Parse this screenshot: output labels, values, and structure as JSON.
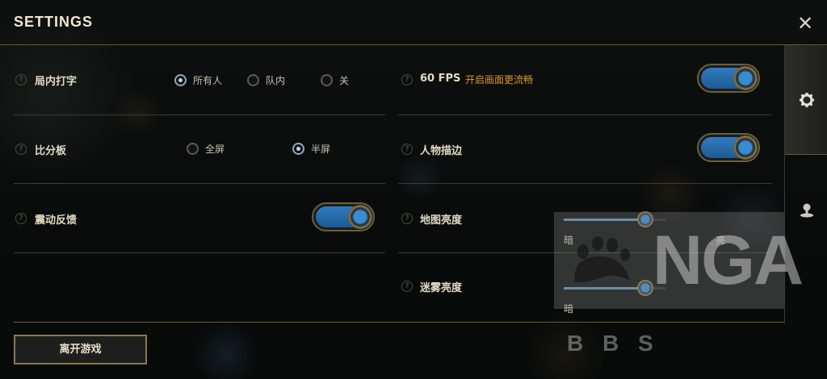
{
  "header": {
    "title": "SETTINGS",
    "close_icon": "close-icon"
  },
  "side_tabs": [
    {
      "icon": "gear-icon",
      "active": true
    },
    {
      "icon": "map-pin-icon",
      "active": false
    }
  ],
  "left": {
    "chat": {
      "label": "局内打字",
      "options": [
        "所有人",
        "队内",
        "关"
      ],
      "selected": "所有人"
    },
    "scoreboard": {
      "label": "比分板",
      "options": [
        "全屏",
        "半屏"
      ],
      "selected": "半屏"
    },
    "vibration": {
      "label": "震动反馈",
      "enabled": true
    }
  },
  "right": {
    "fps": {
      "label": "60 FPS",
      "note": "开启画面更流畅",
      "enabled": true
    },
    "outline": {
      "label": "人物描边",
      "enabled": true
    },
    "map_brightness": {
      "label": "地图亮度",
      "min_label": "暗",
      "max_label": "亮",
      "value": 0.8
    },
    "fog_brightness": {
      "label": "迷雾亮度",
      "min_label": "暗",
      "value": 0.8
    }
  },
  "help_glyph": "?",
  "footer": {
    "exit_label": "离开游戏"
  },
  "watermark": {
    "logo_text": "NGA",
    "bbs_text": "B B S"
  },
  "colors": {
    "accent_blue": "#2f7cc0",
    "gold": "#8a7a4e",
    "note_orange": "#e0962a"
  }
}
